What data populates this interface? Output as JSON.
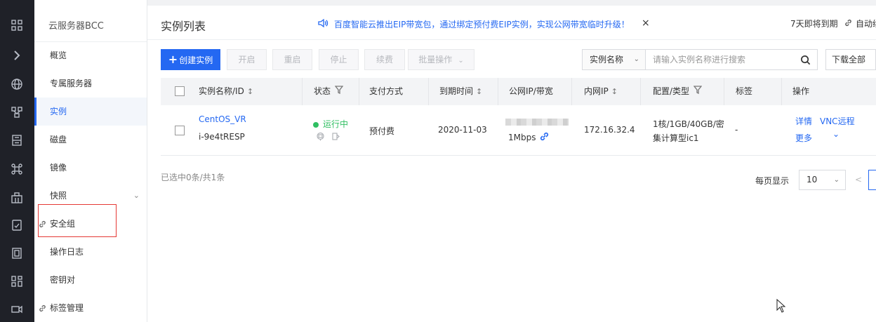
{
  "rail": {
    "icons": [
      "grid-icon",
      "expand-icon",
      "globe-icon",
      "network-icon",
      "storage-icon",
      "command-icon",
      "building-icon",
      "doc-icon",
      "device-icon",
      "apps-icon",
      "video-icon"
    ]
  },
  "sidebar": {
    "title": "云服务器BCC",
    "items": [
      {
        "label": "概览"
      },
      {
        "label": "专属服务器"
      },
      {
        "label": "实例"
      },
      {
        "label": "磁盘"
      },
      {
        "label": "镜像"
      },
      {
        "label": "快照"
      },
      {
        "label": "安全组"
      },
      {
        "label": "操作日志"
      },
      {
        "label": "密钥对"
      },
      {
        "label": "标签管理"
      }
    ]
  },
  "header": {
    "title": "实例列表",
    "notice": "百度智能云推出EIP带宽包，通过绑定预付费EIP实例，实现公网带宽临时升级！",
    "close": "×",
    "expire": "7天即将到期",
    "auto_renew": "自动续"
  },
  "toolbar": {
    "create": "创建实例",
    "start": "开启",
    "restart": "重启",
    "stop": "停止",
    "renew": "续费",
    "batch": "批量操作",
    "search_field": "实例名称",
    "search_placeholder": "请输入实例名称进行搜索",
    "download": "下载全部"
  },
  "table": {
    "columns": {
      "name": "实例名称/ID",
      "status": "状态",
      "pay": "支付方式",
      "expire": "到期时间",
      "public_ip": "公网IP/带宽",
      "private_ip": "内网IP",
      "config": "配置/类型",
      "tags": "标签",
      "actions": "操作"
    },
    "rows": [
      {
        "name": "CentOS_VR",
        "id": "i-9e4tRESP",
        "status": "运行中",
        "pay": "预付费",
        "expire": "2020-11-03",
        "bandwidth": "1Mbps",
        "private_ip": "172.16.32.4",
        "config_line1": "1核/1GB/40GB/密",
        "config_line2": "集计算型ic1",
        "tags": "-",
        "action_detail": "详情",
        "action_vnc": "VNC远程",
        "action_more": "更多"
      }
    ]
  },
  "footer": {
    "selected": "已选中0条/共1条",
    "page_size_label": "每页显示",
    "page_size": "10",
    "prev": "<"
  },
  "colors": {
    "accent": "#2468f2",
    "running": "#30bf62",
    "rail": "#1f2128",
    "highlight": "#e53935"
  }
}
